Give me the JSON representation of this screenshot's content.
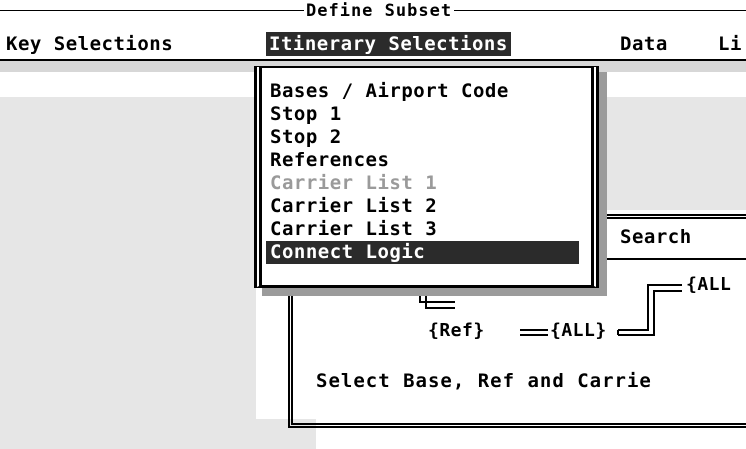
{
  "window": {
    "title": "Define Subset"
  },
  "menu": {
    "items": [
      {
        "label": "Key Selections",
        "active": false
      },
      {
        "label": "Itinerary Selections",
        "active": true
      },
      {
        "label": "Data",
        "active": false
      },
      {
        "label": "Li",
        "active": false
      }
    ]
  },
  "dropdown": {
    "items": [
      {
        "label": "Bases / Airport Code",
        "state": "normal"
      },
      {
        "label": "Stop 1",
        "state": "normal"
      },
      {
        "label": "Stop 2",
        "state": "normal"
      },
      {
        "label": "References",
        "state": "normal"
      },
      {
        "label": "Carrier List 1",
        "state": "disabled"
      },
      {
        "label": "Carrier List 2",
        "state": "normal"
      },
      {
        "label": "Carrier List 3",
        "state": "normal"
      },
      {
        "label": "Connect Logic",
        "state": "selected"
      }
    ]
  },
  "search": {
    "label": "Search"
  },
  "logic": {
    "ref_node": "{Ref}",
    "all_node": "{ALL}",
    "all_node_top": "{ALL",
    "instruction": "Select Base, Ref and Carrie"
  },
  "colors": {
    "highlight": "#2b2b2b",
    "panel": "#e6e6e6",
    "disabled_text": "#9a9a9a"
  }
}
